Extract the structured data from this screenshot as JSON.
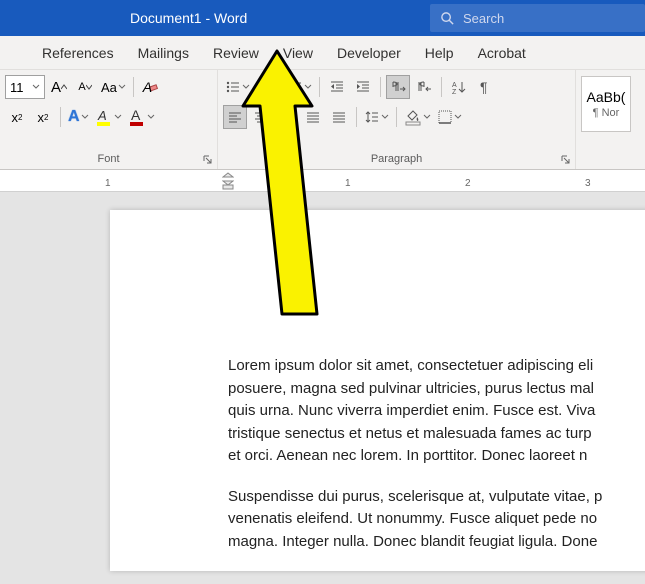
{
  "titlebar": {
    "title": "Document1  -  Word",
    "search_placeholder": "Search"
  },
  "tabs": [
    "References",
    "Mailings",
    "Review",
    "View",
    "Developer",
    "Help",
    "Acrobat"
  ],
  "font": {
    "group_label": "Font",
    "size": "11",
    "sample_A1": "A",
    "sample_A2": "A",
    "caseAa": "Aa",
    "x2_sub": "x",
    "x2_sup": "x",
    "A_texteffects": "A",
    "A_highlight": "A",
    "A_fontcolor": "A",
    "clear_Ao": "A"
  },
  "paragraph": {
    "group_label": "Paragraph"
  },
  "styles": {
    "preview_text": "AaBb(",
    "preview_label": "¶ Nor"
  },
  "ruler": {
    "n1": "1",
    "n1b": "1",
    "n2": "2",
    "n3": "3"
  },
  "doc": {
    "p1_l1": "Lorem ipsum dolor sit amet, consectetuer adipiscing eli",
    "p1_l2": "posuere, magna sed pulvinar ultricies, purus lectus mal",
    "p1_l3": "quis urna. Nunc viverra imperdiet enim. Fusce est. Viva",
    "p1_l4": "tristique senectus et netus et malesuada fames ac turp",
    "p1_l5": "et orci. Aenean nec lorem. In porttitor. Donec laoreet n",
    "p2_l1": "Suspendisse dui purus, scelerisque at, vulputate vitae, p",
    "p2_l2": "venenatis eleifend. Ut nonummy. Fusce aliquet pede no",
    "p2_l3": "magna. Integer nulla. Donec blandit feugiat ligula. Done"
  }
}
